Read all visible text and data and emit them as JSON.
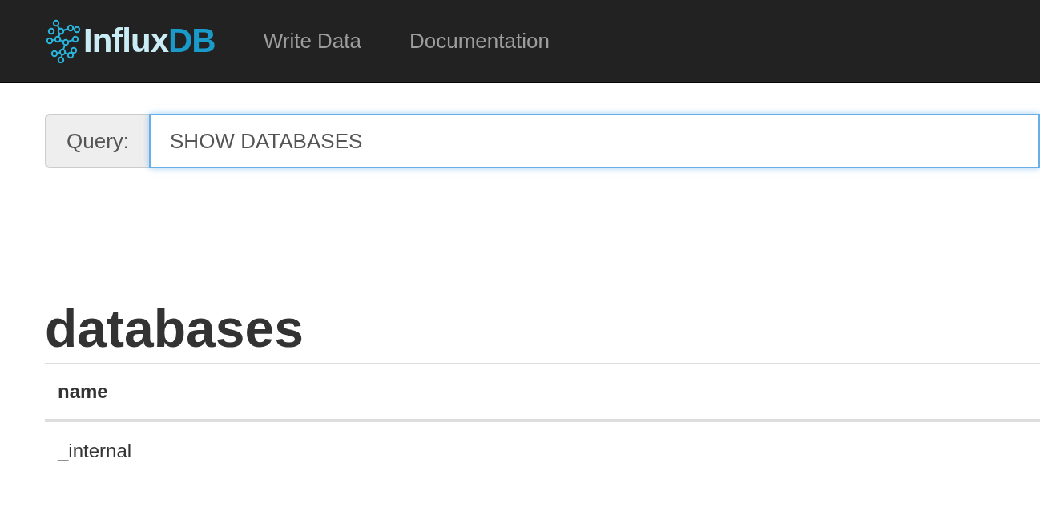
{
  "navbar": {
    "brand": {
      "light": "Influx",
      "accent": "DB"
    },
    "links": [
      {
        "label": "Write Data"
      },
      {
        "label": "Documentation"
      }
    ]
  },
  "query": {
    "label": "Query:",
    "value": "SHOW DATABASES",
    "focused": true
  },
  "result": {
    "title": "databases",
    "table": {
      "columns": [
        "name"
      ],
      "rows": [
        [
          "_internal"
        ]
      ]
    }
  }
}
